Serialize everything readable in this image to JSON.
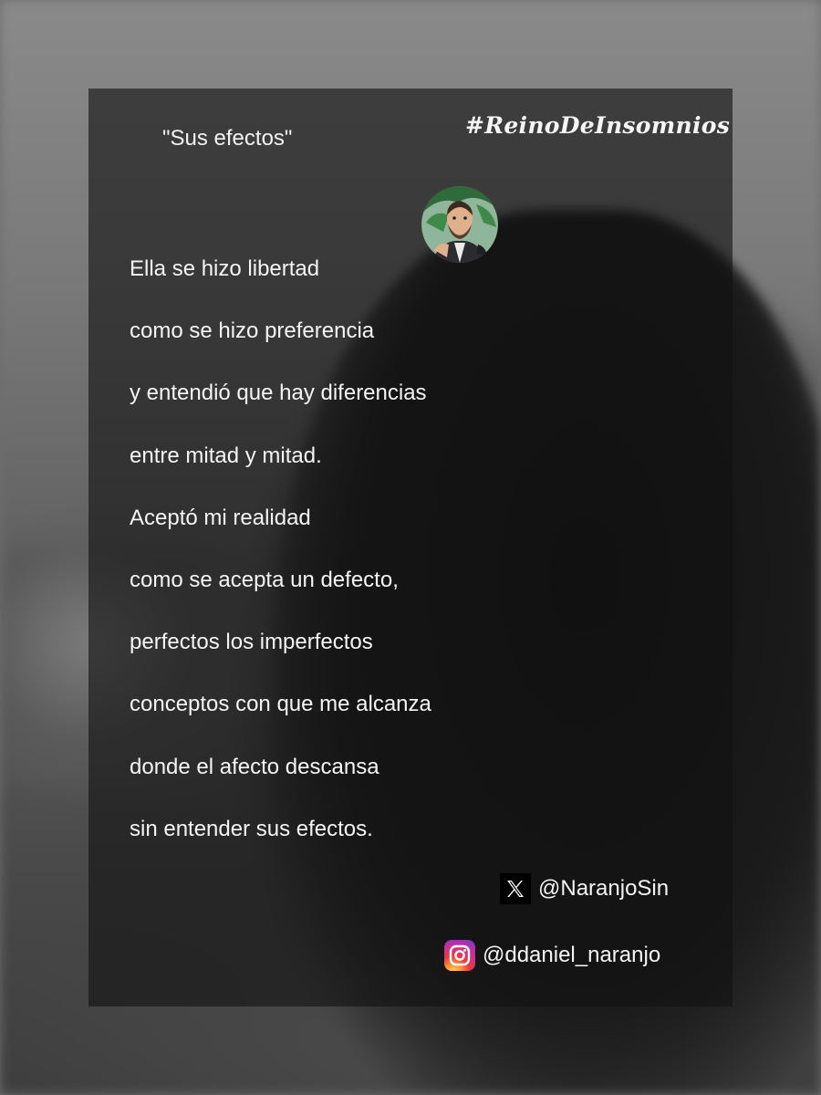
{
  "poem": {
    "title": "\"Sus efectos\"",
    "hashtag": "#ReinoDeInsomnios",
    "lines": [
      "Ella se hizo libertad",
      "como se hizo preferencia",
      "y entendió que hay diferencias",
      "entre mitad y mitad.",
      "Aceptó mi realidad",
      "como se acepta un defecto,",
      "perfectos los imperfectos",
      "conceptos con que me alcanza",
      "donde el afecto descansa",
      "sin entender sus efectos."
    ]
  },
  "social": {
    "x_handle": "@NaranjoSin",
    "x_icon": "x-logo-icon",
    "instagram_handle": "@ddaniel_naranjo",
    "instagram_icon": "instagram-logo-icon"
  },
  "avatar": {
    "icon": "avatar-bearded-man-illustration"
  }
}
